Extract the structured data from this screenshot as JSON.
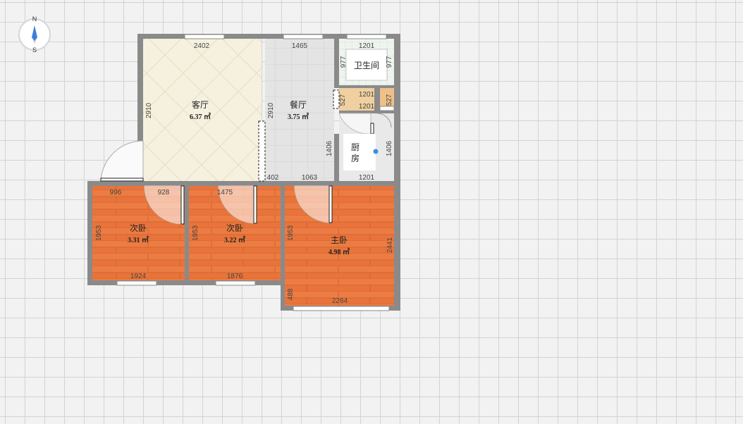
{
  "compass": {
    "north": "N",
    "south": "S"
  },
  "rooms": {
    "living": {
      "name": "客厅",
      "area": "6.37 ㎡"
    },
    "dining": {
      "name": "餐厅",
      "area": "3.75 ㎡"
    },
    "bathroom": {
      "name": "卫生间"
    },
    "kitchen": {
      "name_line1": "厨",
      "name_line2": "房"
    },
    "bedroom2a": {
      "name": "次卧",
      "area": "3.31 ㎡"
    },
    "bedroom2b": {
      "name": "次卧",
      "area": "3.22 ㎡"
    },
    "master": {
      "name": "主卧",
      "area": "4.98 ㎡"
    }
  },
  "dimensions": {
    "living_top": "2402",
    "living_left": "2910",
    "dining_top": "1465",
    "dining_left": "2910",
    "dining_right": "1406",
    "dining_bottom_a": "402",
    "dining_bottom_b": "1063",
    "bath_top": "1201",
    "bath_left": "977",
    "bath_right": "977",
    "utility_top": "1201",
    "utility_bottom": "1201",
    "utility_left": "527",
    "utility_right": "527",
    "kitchen_right": "1406",
    "kitchen_bottom": "1201",
    "bed1_top_a": "996",
    "bed1_top_b": "928",
    "bed1_left": "1953",
    "bed1_bottom": "1924",
    "bed2_top": "1475",
    "bed2_left": "1953",
    "bed2_bottom": "1876",
    "master_left": "1953",
    "master_right": "2441",
    "master_left_low": "488",
    "master_bottom": "2264"
  },
  "colors": {
    "wall": "#8a8a8a",
    "living_floor": "#f6f1df",
    "dining_floor": "#e6e6e6",
    "bedroom_floor": "#e8733a",
    "kitchen_floor": "#e9e9e9",
    "window": "#ffffff"
  }
}
